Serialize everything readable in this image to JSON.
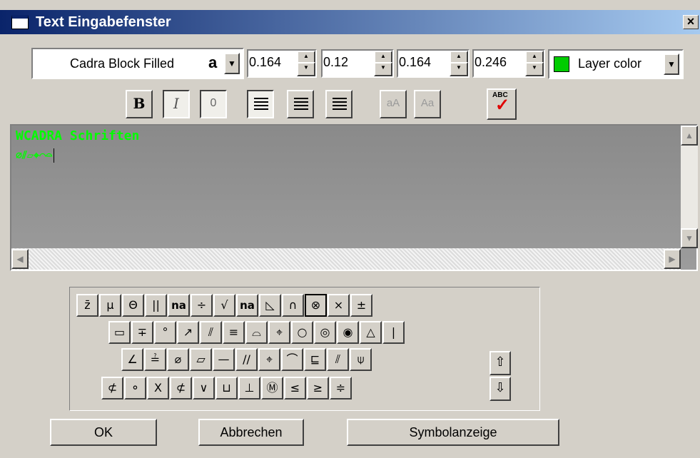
{
  "window": {
    "title": "Text Eingabefenster",
    "close_label": "×"
  },
  "font": {
    "name": "Cadra Block Filled",
    "glyph": "a"
  },
  "params": [
    "0.164",
    "0.12",
    "0.164",
    "0.246"
  ],
  "color": {
    "label": "Layer color",
    "swatch": "#00cc00"
  },
  "toolbar": {
    "bold": "B",
    "italic": "I",
    "outline": "0",
    "small_caps": "aA",
    "title_case": "Aa",
    "spell_check": "ABC"
  },
  "editor": {
    "lines": [
      "WCADRA Schriften",
      "⌀⫽▱⌖⌒⌓"
    ]
  },
  "keyboard": {
    "rows": [
      [
        "z̄",
        "µ",
        "Θ",
        "||",
        "na",
        "÷",
        "√",
        "na",
        "◺",
        "∩",
        "⊗",
        "⨯",
        "±"
      ],
      [
        "▭",
        "∓",
        "°",
        "↗",
        "⫽",
        "≡",
        "⌓",
        "⌖",
        "○",
        "◎",
        "◉",
        "△",
        "|"
      ],
      [
        "∠",
        "≟",
        "⌀",
        "▱",
        "—",
        "//",
        "⌖",
        "⌒",
        "⊑",
        "⫽",
        "⍦"
      ],
      [
        "⊄",
        "⚬",
        "X",
        "⊄",
        "∨",
        "⊔",
        "⊥",
        "Ⓜ",
        "≤",
        "≥",
        "≑"
      ]
    ],
    "shift_up": "⇧",
    "shift_down": "⇩"
  },
  "buttons": {
    "ok": "OK",
    "cancel": "Abbrechen",
    "symbols": "Symbolanzeige"
  }
}
